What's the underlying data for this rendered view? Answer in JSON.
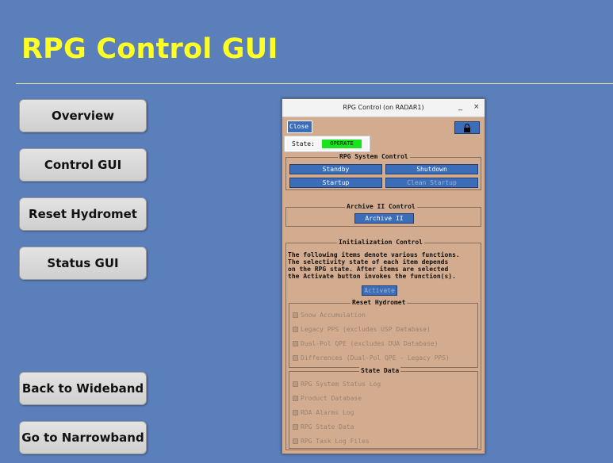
{
  "slide": {
    "title": "RPG Control GUI"
  },
  "nav": [
    {
      "label": "Overview"
    },
    {
      "label": "Control GUI"
    },
    {
      "label": "Reset Hydromet"
    },
    {
      "label": "Status GUI"
    },
    {
      "label": "Back to Wideband"
    },
    {
      "label": "Go to Narrowband"
    }
  ],
  "window": {
    "title": "RPG Control (on RADAR1)",
    "minimize": "_",
    "close_glyph": "×",
    "close_button": "Close",
    "state_label": "State:",
    "state_value": "OPERATE",
    "state_color": "#17e41d",
    "system_control": {
      "label": "RPG System Control",
      "buttons": [
        "Standby",
        "Shutdown",
        "Startup",
        "Clean Startup"
      ]
    },
    "archive": {
      "label": "Archive II Control",
      "button": "Archive II"
    },
    "init": {
      "label": "Initialization Control",
      "description": "The following items denote various functions.\nThe selectivity state of each item depends\non the RPG state.  After items are selected\nthe Activate button invokes the function(s).",
      "activate": "Activate"
    },
    "reset_hydromet": {
      "label": "Reset Hydromet",
      "items": [
        "Snow Accumulation",
        "Legacy PPS (excludes USP Database)",
        "Dual-Pol QPE (excludes DUA Database)",
        "Differences (Dual-Pol QPE - Legacy PPS)"
      ]
    },
    "state_data": {
      "label": "State Data",
      "items": [
        "RPG System Status Log",
        "Product Database",
        "RDA Alarms Log",
        "RPG State Data",
        "RPG Task Log Files"
      ]
    },
    "colors": {
      "panel": "#d3ac8f",
      "button": "#3b6db8"
    }
  }
}
